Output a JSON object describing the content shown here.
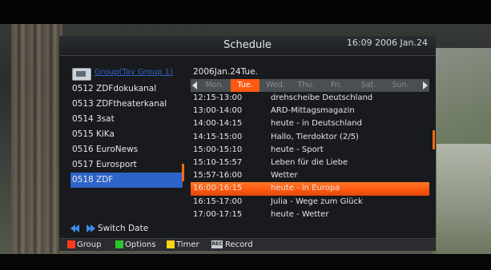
{
  "header": {
    "title": "Schedule",
    "clock": "16:09 2006 Jan.24"
  },
  "group": {
    "icon": "tv-group-icon",
    "name": "Group(Tav Group 1)"
  },
  "channels": [
    {
      "num": "0512",
      "name": "ZDFdokukanal"
    },
    {
      "num": "0513",
      "name": "ZDFtheaterkanal"
    },
    {
      "num": "0514",
      "name": "3sat"
    },
    {
      "num": "0515",
      "name": "KiKa"
    },
    {
      "num": "0516",
      "name": "EuroNews"
    },
    {
      "num": "0517",
      "name": "Eurosport"
    },
    {
      "num": "0518",
      "name": "ZDF"
    }
  ],
  "selected_channel": "0518",
  "schedule": {
    "date": "2006Jan.24Tue.",
    "days": [
      "Mon.",
      "Tue.",
      "Wed.",
      "Thu.",
      "Fri.",
      "Sat.",
      "Sun."
    ],
    "active_day": "Tue.",
    "events": [
      {
        "time": "12:15-13:00",
        "title": "drehscheibe Deutschland"
      },
      {
        "time": "13:00-14:00",
        "title": "ARD-Mittagsmagazin"
      },
      {
        "time": "14:00-14:15",
        "title": "heute - in Deutschland"
      },
      {
        "time": "14:15-15:00",
        "title": "Hallo, Tierdoktor (2/5)"
      },
      {
        "time": "15:00-15:10",
        "title": "heute - Sport"
      },
      {
        "time": "15:10-15:57",
        "title": "Leben für die Liebe"
      },
      {
        "time": "15:57-16:00",
        "title": "Wetter"
      },
      {
        "time": "16:00-16:15",
        "title": "heute - in Europa"
      },
      {
        "time": "16:15-17:00",
        "title": "Julia - Wege zum Glück"
      },
      {
        "time": "17:00-17:15",
        "title": "heute - Wetter"
      }
    ],
    "selected_event_index": 7
  },
  "switch_date": {
    "label": "Switch Date",
    "icon": "rewind-forward-icon",
    "color": "#3e8cf0"
  },
  "footer": {
    "items": [
      {
        "label": "Group",
        "color": "#ff3b1f"
      },
      {
        "label": "Options",
        "color": "#2ec52e"
      },
      {
        "label": "Timer",
        "color": "#ffd21a"
      },
      {
        "label": "Record",
        "badge": "REC"
      }
    ]
  },
  "colors": {
    "accent": "#ff5a10",
    "selection_blue": "#2d64c9",
    "link_blue": "#2e63c9"
  }
}
